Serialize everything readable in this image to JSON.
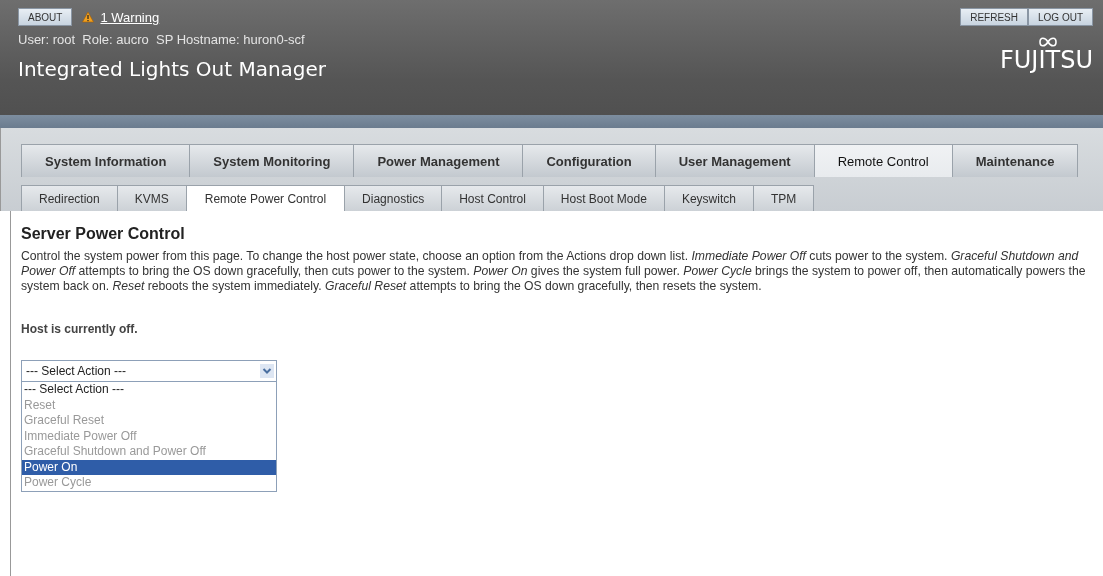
{
  "header": {
    "about_button": "ABOUT",
    "warning_link": "1 Warning",
    "user_info": "User: root  Role: aucro  SP Hostname: huron0-scf",
    "title": "Integrated Lights Out Manager",
    "right_buttons": [
      "REFRESH",
      "LOG OUT"
    ],
    "logo": "FUJITSU"
  },
  "main_tabs": [
    {
      "label": "System Information",
      "selected": false
    },
    {
      "label": "System Monitoring",
      "selected": false
    },
    {
      "label": "Power Management",
      "selected": false
    },
    {
      "label": "Configuration",
      "selected": false
    },
    {
      "label": "User Management",
      "selected": false
    },
    {
      "label": "Remote Control",
      "selected": true
    },
    {
      "label": "Maintenance",
      "selected": false
    }
  ],
  "sub_tabs": [
    {
      "label": "Redirection",
      "selected": false
    },
    {
      "label": "KVMS",
      "selected": false
    },
    {
      "label": "Remote Power Control",
      "selected": true
    },
    {
      "label": "Diagnostics",
      "selected": false
    },
    {
      "label": "Host Control",
      "selected": false
    },
    {
      "label": "Host Boot Mode",
      "selected": false
    },
    {
      "label": "Keyswitch",
      "selected": false
    },
    {
      "label": "TPM",
      "selected": false
    }
  ],
  "content": {
    "heading": "Server Power Control",
    "description": "Control the system power from this page. To change the host power state, choose an option from the Actions drop down list. *Immediate Power Off* cuts power to the system. *Graceful Shutdown and Power Off* attempts to bring the OS down gracefully, then cuts power to the system. *Power On* gives the system full power. *Power Cycle* brings the system to power off, then automatically powers the system back on. *Reset* reboots the system immediately. *Graceful Reset* attempts to bring the OS down gracefully, then resets the system.",
    "host_status": "Host is currently off.",
    "action_select": {
      "value": "--- Select Action ---",
      "options": [
        {
          "label": "--- Select Action ---",
          "disabled": false,
          "highlighted": false
        },
        {
          "label": "Reset",
          "disabled": true,
          "highlighted": false
        },
        {
          "label": "Graceful Reset",
          "disabled": true,
          "highlighted": false
        },
        {
          "label": "Immediate Power Off",
          "disabled": true,
          "highlighted": false
        },
        {
          "label": "Graceful Shutdown and Power Off",
          "disabled": true,
          "highlighted": false
        },
        {
          "label": "Power On",
          "disabled": false,
          "highlighted": true
        },
        {
          "label": "Power Cycle",
          "disabled": true,
          "highlighted": false
        }
      ]
    }
  }
}
